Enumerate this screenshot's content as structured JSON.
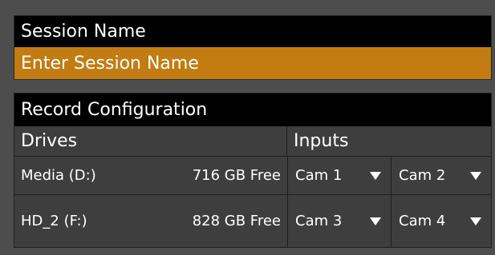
{
  "session": {
    "title": "Session Name",
    "input_value": "",
    "input_placeholder": "Enter Session Name"
  },
  "record": {
    "title": "Record Configuration",
    "headers": {
      "drives": "Drives",
      "inputs": "Inputs"
    },
    "rows": [
      {
        "drive": "Media (D:)",
        "free": "716 GB Free",
        "inputs": [
          "Cam 1",
          "Cam 2"
        ]
      },
      {
        "drive": "HD_2 (F:)",
        "free": "828 GB Free",
        "inputs": [
          "Cam 3",
          "Cam 4"
        ]
      }
    ]
  },
  "colors": {
    "background": "#4d4d4d",
    "header_bar": "#000000",
    "input_accent": "#c27c12",
    "table_bg": "#3e3e3e",
    "text": "#ffffff"
  },
  "icons": {
    "dropdown": "triangle-down-icon"
  }
}
